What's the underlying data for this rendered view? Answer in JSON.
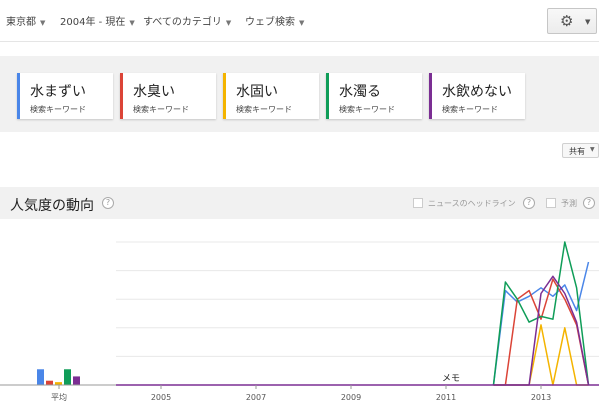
{
  "filters": [
    {
      "label": "東京都"
    },
    {
      "label": "2004年 - 現在"
    },
    {
      "label": "すべてのカテゴリ"
    },
    {
      "label": "ウェブ検索"
    }
  ],
  "terms": [
    {
      "term": "水まずい",
      "sub": "検索キーワード",
      "color": "#4a86e8"
    },
    {
      "term": "水臭い",
      "sub": "検索キーワード",
      "color": "#db4437"
    },
    {
      "term": "水固い",
      "sub": "検索キーワード",
      "color": "#f4b400"
    },
    {
      "term": "水濁る",
      "sub": "検索キーワード",
      "color": "#0f9d58"
    },
    {
      "term": "水飲めない",
      "sub": "検索キーワード",
      "color": "#7b2e93"
    }
  ],
  "share_label": "共有",
  "section": {
    "title": "人気度の動向",
    "news_label": "ニュースのヘッドライン",
    "forecast_label": "予測"
  },
  "chart_data": {
    "type": "line",
    "x_ticks": [
      "2005",
      "2007",
      "2009",
      "2011",
      "2013"
    ],
    "average_label": "平均",
    "annotation": "メモ",
    "ylim": [
      0,
      100
    ],
    "grid": true,
    "average": [
      {
        "name": "水まずい",
        "value": 11
      },
      {
        "name": "水臭い",
        "value": 3
      },
      {
        "name": "水固い",
        "value": 2
      },
      {
        "name": "水濁る",
        "value": 11
      },
      {
        "name": "水飲めない",
        "value": 6
      }
    ],
    "x": [
      2012.0,
      2012.25,
      2012.5,
      2012.75,
      2013.0,
      2013.25,
      2013.5,
      2013.75,
      2014.0
    ],
    "series": [
      {
        "name": "水まずい",
        "color": "#4a86e8",
        "values": [
          0,
          66,
          58,
          62,
          68,
          62,
          70,
          52,
          86
        ]
      },
      {
        "name": "水臭い",
        "color": "#db4437",
        "values": [
          0,
          0,
          60,
          66,
          46,
          74,
          60,
          42,
          0
        ]
      },
      {
        "name": "水固い",
        "color": "#f4b400",
        "values": [
          0,
          0,
          0,
          0,
          42,
          0,
          40,
          0,
          0
        ]
      },
      {
        "name": "水濁る",
        "color": "#0f9d58",
        "values": [
          0,
          72,
          60,
          44,
          48,
          46,
          100,
          68,
          0
        ]
      },
      {
        "name": "水飲めない",
        "color": "#7b2e93",
        "values": [
          0,
          0,
          0,
          0,
          64,
          76,
          64,
          44,
          0
        ]
      }
    ]
  }
}
